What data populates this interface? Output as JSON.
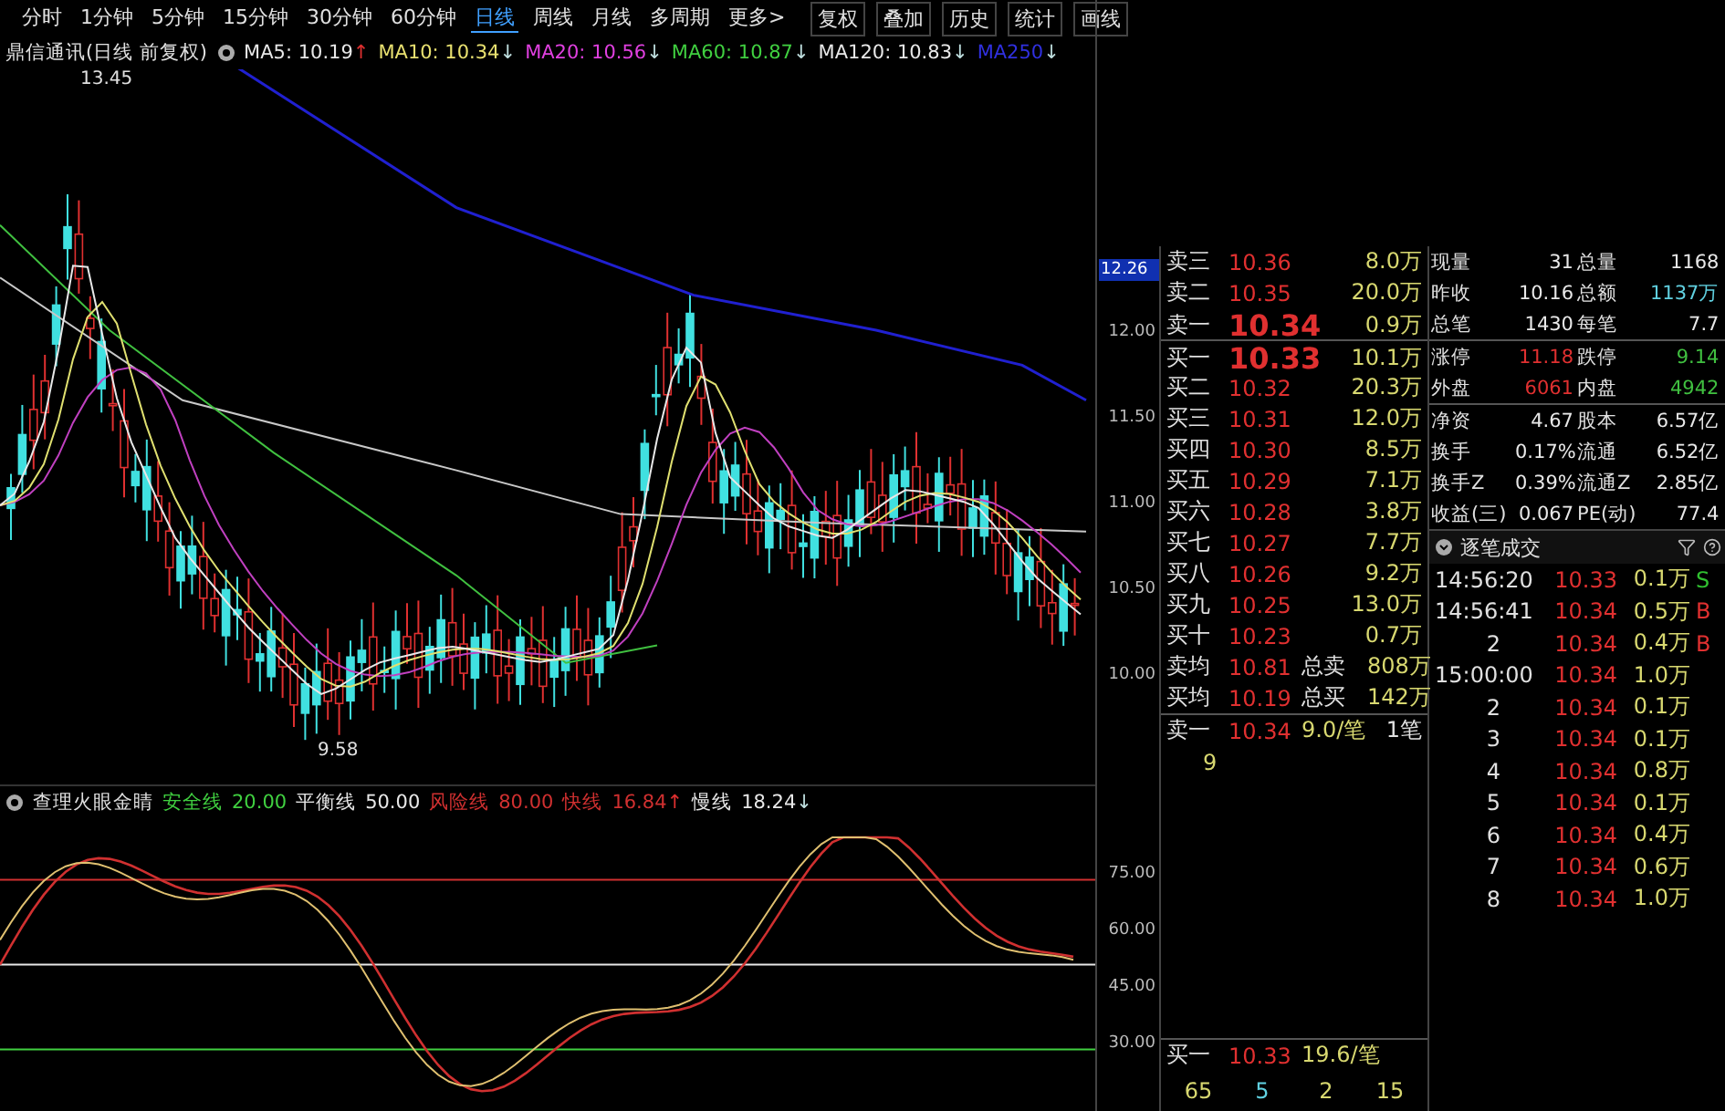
{
  "toolbar": {
    "periods": [
      {
        "label": "分时",
        "selected": false
      },
      {
        "label": "1分钟",
        "selected": false
      },
      {
        "label": "5分钟",
        "selected": false
      },
      {
        "label": "15分钟",
        "selected": false
      },
      {
        "label": "30分钟",
        "selected": false
      },
      {
        "label": "60分钟",
        "selected": false
      },
      {
        "label": "日线",
        "selected": true
      },
      {
        "label": "周线",
        "selected": false
      },
      {
        "label": "月线",
        "selected": false
      },
      {
        "label": "多周期",
        "selected": false
      },
      {
        "label": "更多>",
        "selected": false
      }
    ],
    "buttons": [
      "复权",
      "叠加",
      "历史",
      "统计",
      "画线"
    ]
  },
  "legend": {
    "title": "鼎信通讯(日线 前复权)",
    "ma": [
      {
        "label": "MA5: 10.19",
        "color": "#e8e8e8",
        "arrow": {
          "text": "↑",
          "color": "#e03030"
        }
      },
      {
        "label": "MA10: 10.34",
        "color": "#e8e070",
        "arrow": {
          "text": "↓",
          "color": "#c0e0e0"
        }
      },
      {
        "label": "MA20: 10.56",
        "color": "#e040e0",
        "arrow": {
          "text": "↓",
          "color": "#c0e0e0"
        }
      },
      {
        "label": "MA60: 10.87",
        "color": "#40d040",
        "arrow": {
          "text": "↓",
          "color": "#c0e0e0"
        }
      },
      {
        "label": "MA120: 10.83",
        "color": "#e8e8e8",
        "arrow": {
          "text": "↓",
          "color": "#c0e0e0"
        }
      },
      {
        "label": "MA250",
        "color": "#3030e0",
        "arrow": {
          "text": "↓",
          "color": "#c0e0e0"
        }
      }
    ]
  },
  "main_chart": {
    "high_label": "13.45",
    "low_label": "9.58"
  },
  "price_axis": {
    "current": "12.26",
    "ticks": [
      "12.00",
      "11.50",
      "11.00",
      "10.50",
      "10.00"
    ]
  },
  "indicator": {
    "name": "查理火眼金睛",
    "lines": [
      {
        "label": "安全线",
        "value": "20.00",
        "color": "#40d040"
      },
      {
        "label": "平衡线",
        "value": "50.00",
        "color": "#e8e8e8"
      },
      {
        "label": "风险线",
        "value": "80.00",
        "color": "#d03030"
      },
      {
        "label": "快线",
        "value": "16.84",
        "color": "#d03030",
        "arrow": {
          "text": "↑",
          "color": "#e03030"
        }
      },
      {
        "label": "慢线",
        "value": "18.24",
        "color": "#e8e8e8",
        "arrow": {
          "text": "↓",
          "color": "#c0e0e0"
        }
      }
    ]
  },
  "indicator_axis": [
    "75.00",
    "60.00",
    "45.00",
    "30.00"
  ],
  "order_book": {
    "asks": [
      {
        "label": "卖三",
        "price": "10.36",
        "volume": "8.0万"
      },
      {
        "label": "卖二",
        "price": "10.35",
        "volume": "20.0万"
      },
      {
        "label": "卖一",
        "price": "10.34",
        "volume": "0.9万"
      }
    ],
    "bids": [
      {
        "label": "买一",
        "price": "10.33",
        "volume": "10.1万"
      },
      {
        "label": "买二",
        "price": "10.32",
        "volume": "20.3万"
      },
      {
        "label": "买三",
        "price": "10.31",
        "volume": "12.0万"
      },
      {
        "label": "买四",
        "price": "10.30",
        "volume": "8.5万"
      },
      {
        "label": "买五",
        "price": "10.29",
        "volume": "7.1万"
      },
      {
        "label": "买六",
        "price": "10.28",
        "volume": "3.8万"
      },
      {
        "label": "买七",
        "price": "10.27",
        "volume": "7.7万"
      },
      {
        "label": "买八",
        "price": "10.26",
        "volume": "9.2万"
      },
      {
        "label": "买九",
        "price": "10.25",
        "volume": "13.0万"
      },
      {
        "label": "买十",
        "price": "10.23",
        "volume": "0.7万"
      }
    ],
    "averages": [
      {
        "label": "卖均",
        "price": "10.81",
        "total_label": "总卖",
        "total": "808万"
      },
      {
        "label": "买均",
        "price": "10.19",
        "total_label": "总买",
        "total": "142万"
      }
    ],
    "queue_top": {
      "label": "卖一",
      "price": "10.34",
      "per_order": "9.0/笔",
      "orders": "1笔",
      "counts": [
        "9"
      ]
    },
    "queue_bottom": {
      "label": "买一",
      "price": "10.33",
      "per_order": "19.6/笔",
      "counts": [
        "65",
        "5",
        "2",
        "15"
      ]
    }
  },
  "stats": [
    [
      {
        "label": "现量",
        "value": "31",
        "color": "#e8e8e8"
      },
      {
        "label": "总量",
        "value": "1168",
        "color": "#e8e8e8"
      }
    ],
    [
      {
        "label": "昨收",
        "value": "10.16",
        "color": "#e8e8e8"
      },
      {
        "label": "总额",
        "value": "1137万",
        "color": "#60d0e0"
      }
    ],
    [
      {
        "label": "总笔",
        "value": "1430",
        "color": "#e8e8e8"
      },
      {
        "label": "每笔",
        "value": "7.7",
        "color": "#e8e8e8"
      }
    ],
    [
      {
        "label": "涨停",
        "value": "11.18",
        "color": "#e03030"
      },
      {
        "label": "跌停",
        "value": "9.14",
        "color": "#40c040"
      }
    ],
    [
      {
        "label": "外盘",
        "value": "6061",
        "color": "#e03030"
      },
      {
        "label": "内盘",
        "value": "4942",
        "color": "#40c040"
      }
    ],
    [
      {
        "label": "净资",
        "value": "4.67",
        "color": "#e8e8e8"
      },
      {
        "label": "股本",
        "value": "6.57亿",
        "color": "#e8e8e8"
      }
    ],
    [
      {
        "label": "换手",
        "value": "0.17%",
        "color": "#e8e8e8"
      },
      {
        "label": "流通",
        "value": "6.52亿",
        "color": "#e8e8e8"
      }
    ],
    [
      {
        "label": "换手Z",
        "value": "0.39%",
        "color": "#e8e8e8"
      },
      {
        "label": "流通Z",
        "value": "2.85亿",
        "color": "#e8e8e8"
      }
    ],
    [
      {
        "label": "收益(三)",
        "value": "0.067",
        "color": "#e8e8e8"
      },
      {
        "label": "PE(动)",
        "value": "77.4",
        "color": "#e8e8e8"
      }
    ]
  ],
  "trades": {
    "title": "逐笔成交",
    "rows": [
      {
        "time": "14:56:20",
        "price": "10.33",
        "volume": "0.1万",
        "side": "S",
        "color": "#30c030"
      },
      {
        "time": "14:56:41",
        "price": "10.34",
        "volume": "0.5万",
        "side": "B",
        "color": "#e03030"
      },
      {
        "time": "2",
        "price": "10.34",
        "volume": "0.4万",
        "side": "B",
        "color": "#e03030"
      },
      {
        "time": "15:00:00",
        "price": "10.34",
        "volume": "1.0万"
      },
      {
        "time": "2",
        "price": "10.34",
        "volume": "0.1万"
      },
      {
        "time": "3",
        "price": "10.34",
        "volume": "0.1万"
      },
      {
        "time": "4",
        "price": "10.34",
        "volume": "0.8万"
      },
      {
        "time": "5",
        "price": "10.34",
        "volume": "0.1万"
      },
      {
        "time": "6",
        "price": "10.34",
        "volume": "0.4万"
      },
      {
        "time": "7",
        "price": "10.34",
        "volume": "0.6万"
      },
      {
        "time": "8",
        "price": "10.34",
        "volume": "1.0万"
      }
    ]
  }
}
